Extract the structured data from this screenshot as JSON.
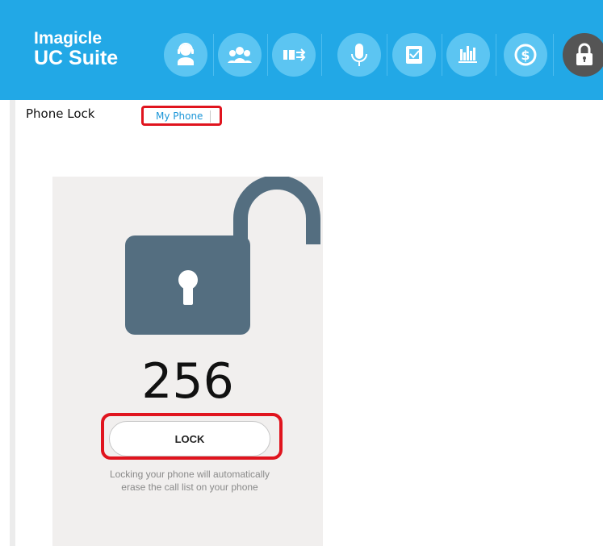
{
  "header": {
    "logo_line1": "Imagicle",
    "logo_line2": "UC Suite",
    "icons": [
      {
        "name": "operator-icon",
        "color": "#ffffff"
      },
      {
        "name": "team-icon",
        "color": "#ffffff"
      },
      {
        "name": "call-routing-icon",
        "color": "#ffffff"
      },
      {
        "name": "microphone-icon",
        "color": "#ffffff"
      },
      {
        "name": "contacts-icon",
        "color": "#ffffff"
      },
      {
        "name": "analytics-icon",
        "color": "#ffffff"
      },
      {
        "name": "billing-icon",
        "color": "#ffffff"
      },
      {
        "name": "phone-lock-icon",
        "color": "#555555"
      }
    ],
    "accent_color": "#22a8e6"
  },
  "page": {
    "title": "Phone Lock",
    "tab_label": "My Phone"
  },
  "lock_panel": {
    "extension": "256",
    "lock_button_label": "LOCK",
    "note": "Locking your phone will automatically erase the call list on your phone",
    "status_icon": "unlocked-padlock-icon",
    "icon_color": "#546e80"
  },
  "highlight_color": "#e0141e"
}
